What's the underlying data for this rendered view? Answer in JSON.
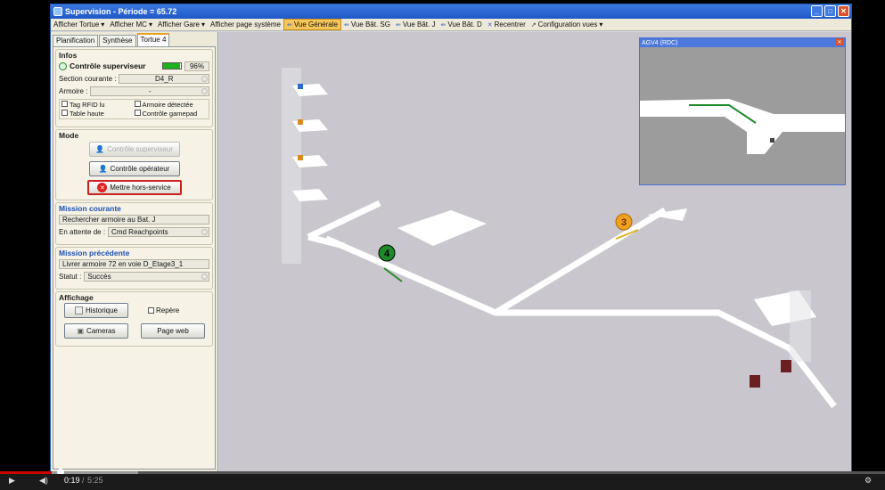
{
  "window": {
    "title": "Supervision - Période = 65.72"
  },
  "menu": [
    {
      "label": "Afficher Tortue",
      "arrow": "▾",
      "active": false
    },
    {
      "label": "Afficher MC",
      "arrow": "▾",
      "active": false
    },
    {
      "label": "Afficher Gare",
      "arrow": "▾",
      "active": false
    },
    {
      "label": "Afficher page système",
      "arrow": "",
      "active": false
    },
    {
      "label": "Vue Générale",
      "arrow": "",
      "active": true,
      "icon": "view-icon"
    },
    {
      "label": "Vue Bât. SG",
      "arrow": "",
      "active": false,
      "icon": "view-icon"
    },
    {
      "label": "Vue Bât. J",
      "arrow": "",
      "active": false,
      "icon": "view-icon"
    },
    {
      "label": "Vue Bât. D",
      "arrow": "",
      "active": false,
      "icon": "view-icon"
    },
    {
      "label": "Recentrer",
      "arrow": "",
      "active": false,
      "icon": "recenter-icon"
    },
    {
      "label": "Configuration vues",
      "arrow": "▾",
      "active": false,
      "icon": "wrench-icon"
    }
  ],
  "tabs": [
    {
      "label": "Planification"
    },
    {
      "label": "Synthèse"
    },
    {
      "label": "Tortue 4"
    }
  ],
  "infos": {
    "title": "Infos",
    "supervisor_label": "Contrôle superviseur",
    "battery_pct": "96%",
    "battery_level": 0.96,
    "section_label": "Section courante :",
    "section_value": "D4_R",
    "armoire_label": "Armoire :",
    "armoire_value": "-",
    "checks": [
      "Tag RFID lu",
      "Armoire détectée",
      "Table haute",
      "Contrôle gamepad"
    ]
  },
  "mode": {
    "title": "Mode",
    "btn_superviseur": "Contrôle superviseur",
    "btn_operateur": "Contrôle opérateur",
    "btn_hors_service": "Mettre hors-service"
  },
  "mission_courante": {
    "title": "Mission courante",
    "value": "Rechercher armoire au Bat. J",
    "attente_label": "En attente de :",
    "attente_value": "Cmd Reachpoints"
  },
  "mission_precedente": {
    "title": "Mission précédente",
    "value": "Livrer armoire 72 en voie D_Etage3_1",
    "statut_label": "Statut :",
    "statut_value": "Succès"
  },
  "affichage": {
    "title": "Affichage",
    "btn_historique": "Historique",
    "repere_label": "Repère",
    "btn_cameras": "Cameras",
    "btn_page_web": "Page web"
  },
  "view3d": {
    "inset_title": "AGV4 (RDC)",
    "agv_markers": [
      {
        "label": "4",
        "color": "#1d8a2a"
      },
      {
        "label": "3",
        "color": "#f0a020"
      }
    ]
  },
  "player": {
    "time_current": "0:19",
    "time_total": "5:25",
    "progress": 0.0585,
    "buffered": 0.156
  }
}
